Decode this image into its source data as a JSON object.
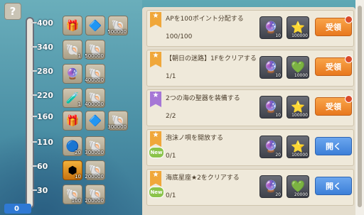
{
  "help_label": "?",
  "gauge": {
    "ticks": [
      "400",
      "340",
      "280",
      "220",
      "160",
      "110",
      "60",
      "30"
    ],
    "current_value": "0",
    "fill_fraction": 0.0
  },
  "milestones": [
    {
      "items": [
        {
          "icon": "gift-box-icon",
          "glyph": "🎁",
          "style": "",
          "qty": ""
        },
        {
          "icon": "blue-gem-icon",
          "glyph": "🔷",
          "style": "",
          "qty": ""
        },
        {
          "icon": "shell-icon",
          "glyph": "🐚",
          "style": "",
          "qty": "500000"
        }
      ]
    },
    {
      "items": [
        {
          "icon": "rainbow-shell-icon",
          "glyph": "🐚",
          "style": "",
          "qty": "1"
        },
        {
          "icon": "shell-icon",
          "glyph": "🐚",
          "style": "",
          "qty": "500000"
        }
      ]
    },
    {
      "items": [
        {
          "icon": "colorful-orb-icon",
          "glyph": "🔮",
          "style": "",
          "qty": ""
        },
        {
          "icon": "shell-icon",
          "glyph": "🐚",
          "style": "",
          "qty": "400000"
        }
      ]
    },
    {
      "items": [
        {
          "icon": "red-potion-icon",
          "glyph": "🧪",
          "style": "",
          "qty": "1"
        },
        {
          "icon": "shell-icon",
          "glyph": "🐚",
          "style": "",
          "qty": "400000"
        }
      ]
    },
    {
      "items": [
        {
          "icon": "gift-box-icon",
          "glyph": "🎁",
          "style": "",
          "qty": ""
        },
        {
          "icon": "blue-gem-icon",
          "glyph": "🔷",
          "style": "",
          "qty": ""
        },
        {
          "icon": "shell-icon",
          "glyph": "🐚",
          "style": "",
          "qty": "300000"
        }
      ]
    },
    {
      "items": [
        {
          "icon": "blue-orb-icon",
          "glyph": "🔵",
          "style": "",
          "qty": "20"
        },
        {
          "icon": "shell-icon",
          "glyph": "🐚",
          "style": "",
          "qty": "300000"
        }
      ]
    },
    {
      "items": [
        {
          "icon": "orange-hexagon-icon",
          "glyph": "⬢",
          "style": "orange",
          "qty": "10"
        },
        {
          "icon": "shell-icon",
          "glyph": "🐚",
          "style": "",
          "qty": "200000"
        }
      ]
    },
    {
      "items": [
        {
          "icon": "rainbow-shell-icon",
          "glyph": "🐚",
          "style": "",
          "qty": "100"
        },
        {
          "icon": "shell-icon",
          "glyph": "🐚",
          "style": "",
          "qty": "200000"
        }
      ]
    }
  ],
  "quests": [
    {
      "ribbon": "orange",
      "new": false,
      "title": "APを100ポイント分配する",
      "progress": "100/100",
      "rewards": [
        {
          "icon": "blue-orb-icon",
          "glyph": "🔮",
          "qty": "10"
        },
        {
          "icon": "silver-star-icon",
          "glyph": "⭐",
          "qty": "100000"
        }
      ],
      "button": "受領",
      "button_style": "orange",
      "dot": true
    },
    {
      "ribbon": "orange",
      "new": false,
      "title": "【朝日の迷路】1Fをクリアする",
      "progress": "1/1",
      "rewards": [
        {
          "icon": "blue-orb-icon",
          "glyph": "🔮",
          "qty": "10"
        },
        {
          "icon": "green-gem-icon",
          "glyph": "💚",
          "qty": "10000"
        }
      ],
      "button": "受領",
      "button_style": "orange",
      "dot": true
    },
    {
      "ribbon": "purple",
      "new": false,
      "title": "2つの海の聖器を装備する",
      "progress": "2/2",
      "rewards": [
        {
          "icon": "blue-orb-icon",
          "glyph": "🔮",
          "qty": "10"
        },
        {
          "icon": "silver-star-icon",
          "glyph": "⭐",
          "qty": "100000"
        }
      ],
      "button": "受領",
      "button_style": "orange",
      "dot": true
    },
    {
      "ribbon": "orange",
      "new": true,
      "title": "泡沫ノ唄を開放する",
      "progress": "0/1",
      "rewards": [
        {
          "icon": "blue-orb-icon",
          "glyph": "🔮",
          "qty": "20"
        },
        {
          "icon": "silver-star-icon",
          "glyph": "⭐",
          "qty": "100000"
        }
      ],
      "button": "開く",
      "button_style": "blue",
      "dot": false
    },
    {
      "ribbon": "orange",
      "new": true,
      "title": "海底星座★2をクリアする",
      "progress": "0/1",
      "rewards": [
        {
          "icon": "blue-orb-icon",
          "glyph": "🔮",
          "qty": "20"
        },
        {
          "icon": "green-gem-icon",
          "glyph": "💚",
          "qty": "20000"
        }
      ],
      "button": "開く",
      "button_style": "blue",
      "dot": false
    }
  ],
  "new_badge_label": "New"
}
